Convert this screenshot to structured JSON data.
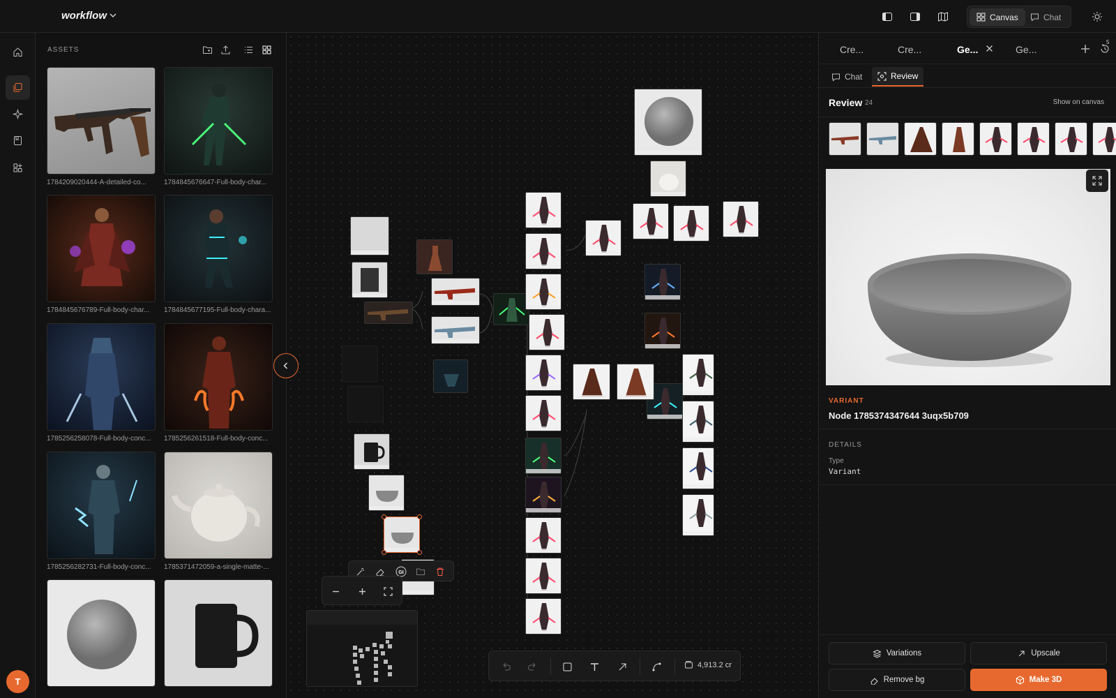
{
  "app": {
    "title": "workflow"
  },
  "modes": {
    "canvas": "Canvas",
    "chat": "Chat"
  },
  "rail": {
    "avatar_initial": "T"
  },
  "assets": {
    "title": "ASSETS",
    "items": [
      {
        "caption": "1784209020444-A-detailed-co...",
        "kind": "rifle"
      },
      {
        "caption": "1784845676647-Full-body-char...",
        "kind": "char-green"
      },
      {
        "caption": "1784845676789-Full-body-char...",
        "kind": "char-purple"
      },
      {
        "caption": "1784845677195-Full-body-chara...",
        "kind": "char-cyan"
      },
      {
        "caption": "1785256258078-Full-body-conc...",
        "kind": "char-ice"
      },
      {
        "caption": "1785256261518-Full-body-conc...",
        "kind": "char-fire"
      },
      {
        "caption": "1785256282731-Full-body-conc...",
        "kind": "char-storm"
      },
      {
        "caption": "1785371472059-a-single-matte-...",
        "kind": "teapot"
      },
      {
        "caption": "",
        "kind": "sphere"
      },
      {
        "caption": "",
        "kind": "mug"
      }
    ]
  },
  "canvas": {
    "credits": "4,913.2 cr"
  },
  "right_panel": {
    "tabs": [
      "Cre...",
      "Cre...",
      "Ge...",
      "Ge..."
    ],
    "active_tab": 2,
    "history_count": "5",
    "subtabs": {
      "chat": "Chat",
      "review": "Review"
    },
    "review": {
      "title": "Review",
      "count": "24",
      "show_on_canvas": "Show on canvas"
    },
    "variant_label": "VARIANT",
    "node_title": "Node 1785374347644 3uqx5b709",
    "details_label": "DETAILS",
    "type_label": "Type",
    "type_value": "Variant",
    "actions": {
      "variations": "Variations",
      "upscale": "Upscale",
      "remove_bg": "Remove bg",
      "make_3d": "Make 3D"
    }
  },
  "colors": {
    "accent": "#e8692f",
    "bg": "#0d0d0d",
    "panel": "#141414"
  }
}
